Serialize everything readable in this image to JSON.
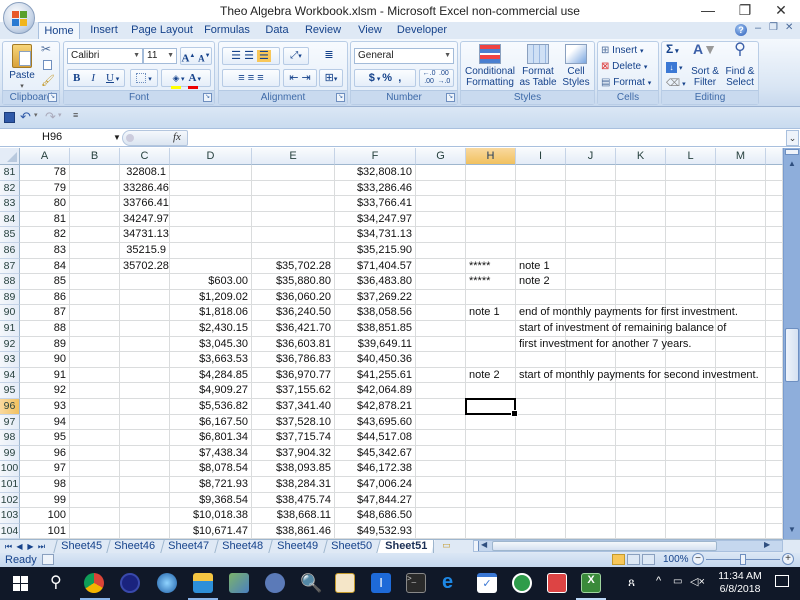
{
  "window": {
    "title": "Theo Algebra Workbook.xlsm - Microsoft Excel non-commercial use",
    "controls": {
      "minimize": "—",
      "restore": "❐",
      "close": "✕"
    }
  },
  "ribbon": {
    "tabs": [
      {
        "label": "Home",
        "active": true
      },
      {
        "label": "Insert"
      },
      {
        "label": "Page Layout"
      },
      {
        "label": "Formulas"
      },
      {
        "label": "Data"
      },
      {
        "label": "Review"
      },
      {
        "label": "View"
      },
      {
        "label": "Developer"
      }
    ],
    "groups": {
      "clipboard": {
        "label": "Clipboard",
        "paste": "Paste"
      },
      "font": {
        "label": "Font",
        "font_name": "Calibri",
        "font_size": "11",
        "bold": "B",
        "italic": "I",
        "underline": "U",
        "grow": "A",
        "shrink": "A"
      },
      "alignment": {
        "label": "Alignment"
      },
      "number": {
        "label": "Number",
        "format": "General",
        "currency": "$",
        "percent": "%",
        "comma": ",",
        "inc_decimal": "+.0\n.00",
        "dec_decimal": ".00\n→.0"
      },
      "styles": {
        "label": "Styles",
        "conditional": "Conditional\nFormatting",
        "format_table": "Format\nas Table",
        "cell_styles": "Cell\nStyles"
      },
      "cells": {
        "label": "Cells",
        "insert": "Insert",
        "delete": "Delete",
        "format": "Format"
      },
      "editing": {
        "label": "Editing",
        "sort": "Sort &\nFilter",
        "find": "Find &\nSelect"
      }
    }
  },
  "formula_bar": {
    "name_box": "H96",
    "fx": "fx",
    "formula": ""
  },
  "columns": [
    "A",
    "B",
    "C",
    "D",
    "E",
    "F",
    "G",
    "H",
    "I",
    "J",
    "K",
    "L",
    "M"
  ],
  "selected": {
    "column": "H",
    "row": 96
  },
  "rows": [
    {
      "n": 81,
      "A": "78",
      "C": "32808.1",
      "F": "$32,808.10"
    },
    {
      "n": 82,
      "A": "79",
      "C": "33286.46",
      "F": "$33,286.46"
    },
    {
      "n": 83,
      "A": "80",
      "C": "33766.41",
      "F": "$33,766.41"
    },
    {
      "n": 84,
      "A": "81",
      "C": "34247.97",
      "F": "$34,247.97"
    },
    {
      "n": 85,
      "A": "82",
      "C": "34731.13",
      "F": "$34,731.13"
    },
    {
      "n": 86,
      "A": "83",
      "C": "35215.9",
      "F": "$35,215.90"
    },
    {
      "n": 87,
      "A": "84",
      "C": "35702.28",
      "E": "$35,702.28",
      "F": "$71,404.57",
      "H": "*****",
      "I": "note 1"
    },
    {
      "n": 88,
      "A": "85",
      "D": "$603.00",
      "E": "$35,880.80",
      "F": "$36,483.80",
      "H": "*****",
      "I": "note 2"
    },
    {
      "n": 89,
      "A": "86",
      "D": "$1,209.02",
      "E": "$36,060.20",
      "F": "$37,269.22"
    },
    {
      "n": 90,
      "A": "87",
      "D": "$1,818.06",
      "E": "$36,240.50",
      "F": "$38,058.56",
      "H": "note 1",
      "I": "end of monthly payments for first investment."
    },
    {
      "n": 91,
      "A": "88",
      "D": "$2,430.15",
      "E": "$36,421.70",
      "F": "$38,851.85",
      "I": "start of investment of remaining balance of"
    },
    {
      "n": 92,
      "A": "89",
      "D": "$3,045.30",
      "E": "$36,603.81",
      "F": "$39,649.11",
      "I": "first investment for another 7 years."
    },
    {
      "n": 93,
      "A": "90",
      "D": "$3,663.53",
      "E": "$36,786.83",
      "F": "$40,450.36"
    },
    {
      "n": 94,
      "A": "91",
      "D": "$4,284.85",
      "E": "$36,970.77",
      "F": "$41,255.61",
      "H": "note 2",
      "I": "start of monthly payments for second investment."
    },
    {
      "n": 95,
      "A": "92",
      "D": "$4,909.27",
      "E": "$37,155.62",
      "F": "$42,064.89"
    },
    {
      "n": 96,
      "A": "93",
      "D": "$5,536.82",
      "E": "$37,341.40",
      "F": "$42,878.21"
    },
    {
      "n": 97,
      "A": "94",
      "D": "$6,167.50",
      "E": "$37,528.10",
      "F": "$43,695.60"
    },
    {
      "n": 98,
      "A": "95",
      "D": "$6,801.34",
      "E": "$37,715.74",
      "F": "$44,517.08"
    },
    {
      "n": 99,
      "A": "96",
      "D": "$7,438.34",
      "E": "$37,904.32",
      "F": "$45,342.67"
    },
    {
      "n": 100,
      "A": "97",
      "D": "$8,078.54",
      "E": "$38,093.85",
      "F": "$46,172.38"
    },
    {
      "n": 101,
      "A": "98",
      "D": "$8,721.93",
      "E": "$38,284.31",
      "F": "$47,006.24"
    },
    {
      "n": 102,
      "A": "99",
      "D": "$9,368.54",
      "E": "$38,475.74",
      "F": "$47,844.27"
    },
    {
      "n": 103,
      "A": "100",
      "D": "$10,018.38",
      "E": "$38,668.11",
      "F": "$48,686.50"
    },
    {
      "n": 104,
      "A": "101",
      "D": "$10,671.47",
      "E": "$38,861.46",
      "F": "$49,532.93"
    }
  ],
  "sheets": [
    {
      "label": "Sheet45"
    },
    {
      "label": "Sheet46"
    },
    {
      "label": "Sheet47"
    },
    {
      "label": "Sheet48"
    },
    {
      "label": "Sheet49"
    },
    {
      "label": "Sheet50"
    },
    {
      "label": "Sheet51",
      "active": true
    }
  ],
  "status": {
    "ready": "Ready",
    "zoom": "100%"
  },
  "taskbar": {
    "time": "11:34 AM",
    "date": "6/8/2018"
  },
  "colors": {
    "accent": "#15428b",
    "selected_header": "#f1c15f",
    "ribbon_bg": "#dae6f4"
  }
}
